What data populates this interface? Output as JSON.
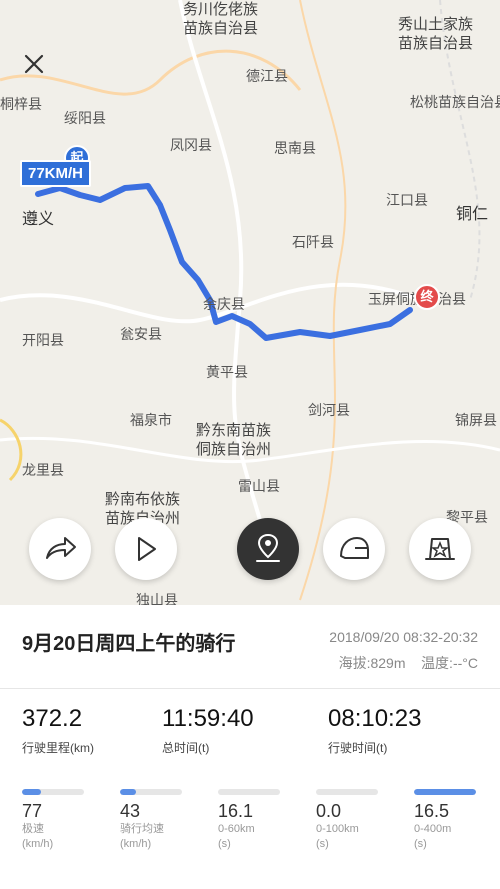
{
  "map": {
    "speed_tag": "77KM/H",
    "start_marker": "起",
    "end_marker": "终",
    "labels": [
      {
        "key": "l1",
        "text": "务川仡佬族\n苗族自治县"
      },
      {
        "key": "l2",
        "text": "秀山土家族\n苗族自治县"
      },
      {
        "key": "l3",
        "text": "德江县"
      },
      {
        "key": "l4",
        "text": "桐梓县"
      },
      {
        "key": "l5",
        "text": "绥阳县"
      },
      {
        "key": "l6",
        "text": "凤冈县"
      },
      {
        "key": "l7",
        "text": "思南县"
      },
      {
        "key": "l8",
        "text": "松桃苗族自治县"
      },
      {
        "key": "l9",
        "text": "遵义"
      },
      {
        "key": "l10",
        "text": "江口县"
      },
      {
        "key": "l11",
        "text": "铜仁"
      },
      {
        "key": "l12",
        "text": "石阡县"
      },
      {
        "key": "l13",
        "text": "余庆县"
      },
      {
        "key": "l14",
        "text": "玉屏侗族自治县"
      },
      {
        "key": "l15",
        "text": "开阳县"
      },
      {
        "key": "l16",
        "text": "瓮安县"
      },
      {
        "key": "l17",
        "text": "黄平县"
      },
      {
        "key": "l18",
        "text": "福泉市"
      },
      {
        "key": "l19",
        "text": "剑河县"
      },
      {
        "key": "l20",
        "text": "锦屏县"
      },
      {
        "key": "l21",
        "text": "黔东南苗族\n侗族自治州"
      },
      {
        "key": "l22",
        "text": "龙里县"
      },
      {
        "key": "l23",
        "text": "雷山县"
      },
      {
        "key": "l24",
        "text": "黔南布依族\n苗族自治州"
      },
      {
        "key": "l25",
        "text": "黎平县"
      },
      {
        "key": "l26",
        "text": "独山县"
      }
    ]
  },
  "ride": {
    "title": "9月20日周四上午的骑行",
    "datetime": "2018/09/20 08:32-20:32",
    "altitude": "海拔:829m",
    "temperature": "温度:--°C"
  },
  "stats": [
    {
      "value": "372.2",
      "label": "行驶里程(km)"
    },
    {
      "value": "11:59:40",
      "label": "总时间(t)"
    },
    {
      "value": "08:10:23",
      "label": "行驶时间(t)"
    }
  ],
  "metrics": [
    {
      "value": "77",
      "label1": "极速",
      "label2": "(km/h)",
      "fill": 0.3
    },
    {
      "value": "43",
      "label1": "骑行均速",
      "label2": "(km/h)",
      "fill": 0.25
    },
    {
      "value": "16.1",
      "label1": "0-60km",
      "label2": "(s)",
      "fill": 0.0
    },
    {
      "value": "0.0",
      "label1": "0-100km",
      "label2": "(s)",
      "fill": 0.0
    },
    {
      "value": "16.5",
      "label1": "0-400m",
      "label2": "(s)",
      "fill": 1.0
    }
  ],
  "colors": {
    "route": "#3b6fe0",
    "accent": "#5b8fe6",
    "end": "#e34b4b"
  }
}
